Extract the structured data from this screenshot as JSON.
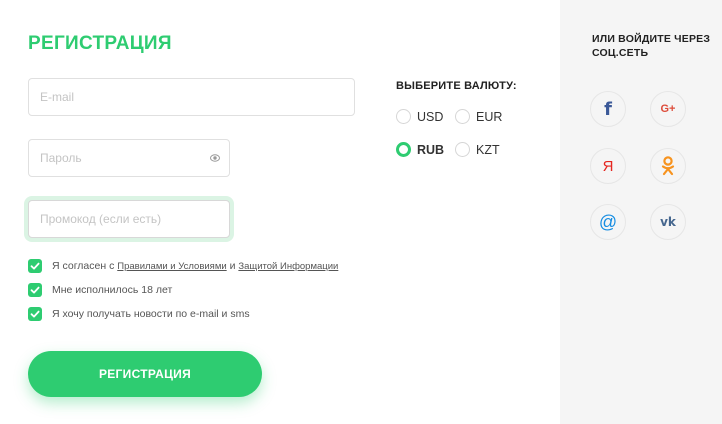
{
  "form": {
    "title": "РЕГИСТРАЦИЯ",
    "email_placeholder": "E-mail",
    "password_placeholder": "Пароль",
    "promo_placeholder": "Промокод (если есть)",
    "submit_label": "РЕГИСТРАЦИЯ"
  },
  "agreements": {
    "terms_prefix": "Я согласен с ",
    "terms_link": "Правилами и Условиями",
    "terms_and": " и ",
    "privacy_link": "Защитой Информации",
    "age": "Мне исполнилось 18 лет",
    "news": "Я хочу получать новости по e-mail и sms"
  },
  "currency": {
    "title": "ВЫБЕРИТЕ ВАЛЮТУ:",
    "options": [
      "USD",
      "EUR",
      "RUB",
      "KZT"
    ],
    "selected": "RUB"
  },
  "social": {
    "title": "ИЛИ ВОЙДИТЕ ЧЕРЕЗ СОЦ.СЕТЬ",
    "icons": {
      "facebook": "f",
      "google": "G+",
      "yandex": "Я",
      "mail": "@",
      "vk": "vk"
    }
  },
  "colors": {
    "accent": "#2ecc71",
    "sidebar_bg": "#f5f5f5",
    "facebook": "#3b5998",
    "google": "#dd4b39",
    "yandex": "#e52620",
    "odnoklassniki": "#f7931e",
    "mail": "#168de2",
    "vk": "#45668e"
  }
}
